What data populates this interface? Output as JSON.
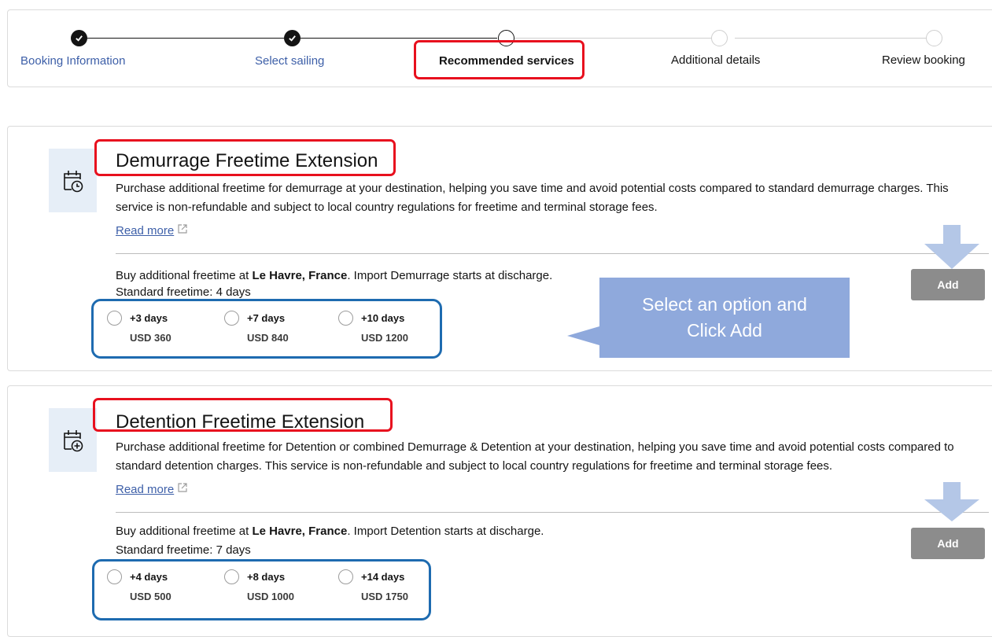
{
  "stepper": {
    "steps": [
      {
        "label": "Booking Information",
        "state": "done"
      },
      {
        "label": "Select sailing",
        "state": "done"
      },
      {
        "label": "Recommended services",
        "state": "current"
      },
      {
        "label": "Additional details",
        "state": "pending"
      },
      {
        "label": "Review booking",
        "state": "pending"
      }
    ]
  },
  "services": [
    {
      "title": "Demurrage Freetime Extension",
      "icon": "calendar-clock-icon",
      "description": "Purchase additional freetime for demurrage at your destination, helping you save time and avoid potential costs compared to standard demurrage charges. This service is non-refundable and subject to local country regulations for freetime and terminal storage fees.",
      "read_more": "Read more",
      "buy_prefix": "Buy additional freetime at ",
      "location": "Le Havre, France",
      "buy_suffix": ". Import Demurrage starts at discharge.",
      "standard_freetime": "Standard freetime: 4 days",
      "options": [
        {
          "days": "+3 days",
          "price": "USD 360"
        },
        {
          "days": "+7 days",
          "price": "USD 840"
        },
        {
          "days": "+10 days",
          "price": "USD 1200"
        }
      ],
      "add_label": "Add"
    },
    {
      "title": "Detention Freetime Extension",
      "icon": "calendar-plus-icon",
      "description": "Purchase additional freetime for Detention or combined Demurrage & Detention at your destination, helping you save time and avoid potential costs compared to standard detention charges. This service is non-refundable and subject to local country regulations for freetime and terminal storage fees.",
      "read_more": "Read more",
      "buy_prefix": "Buy additional freetime at ",
      "location": "Le Havre, France",
      "buy_suffix": ". Import Detention starts at discharge.",
      "standard_freetime": "Standard freetime: 7 days",
      "options": [
        {
          "days": "+4 days",
          "price": "USD 500"
        },
        {
          "days": "+8 days",
          "price": "USD 1000"
        },
        {
          "days": "+14 days",
          "price": "USD 1750"
        }
      ],
      "add_label": "Add"
    }
  ],
  "annotation": {
    "callout_line1": "Select an option and",
    "callout_line2": "Click Add"
  },
  "colors": {
    "link": "#3d5fa8",
    "highlight_red": "#e8101e",
    "highlight_blue": "#1e6bb0",
    "callout": "#8fa9dc",
    "button": "#8c8c8c",
    "icon_bg": "#e6eef7"
  }
}
